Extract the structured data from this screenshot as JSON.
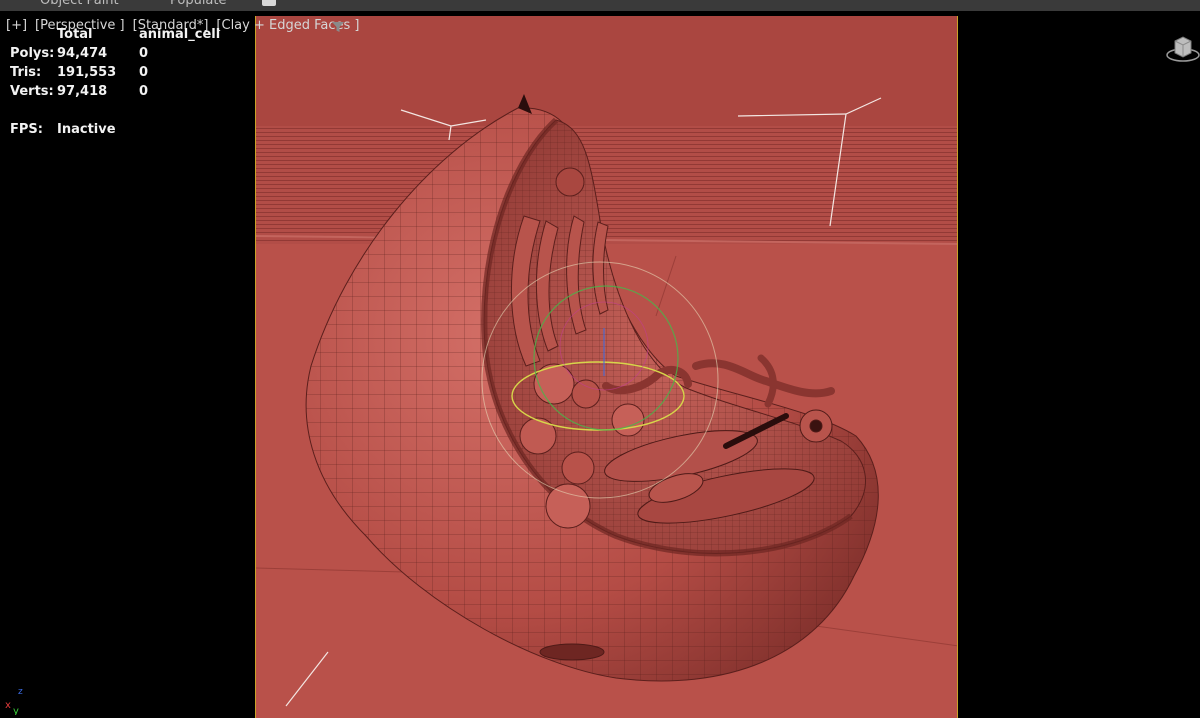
{
  "ribbon": {
    "tabs": [
      "Object Paint",
      "Populate"
    ]
  },
  "viewport": {
    "labels": [
      "[+]",
      "[Perspective ]",
      "[Standard*]",
      "[Clay + Edged Faces ]"
    ],
    "filter_icon": "filter-icon"
  },
  "stats": {
    "header_total": "Total",
    "header_object": "animal_cell",
    "rows": [
      {
        "label": "Polys:",
        "total": "94,474",
        "object": "0"
      },
      {
        "label": "Tris:",
        "total": "191,553",
        "object": "0"
      },
      {
        "label": "Verts:",
        "total": "97,418",
        "object": "0"
      }
    ],
    "fps_label": "FPS:",
    "fps_value": "Inactive"
  },
  "axis_gizmo": {
    "x": "x",
    "y": "y",
    "z": "z"
  },
  "colors": {
    "clay": "#b9514a",
    "clay_dark": "#8a3530",
    "safe_frame": "#c9a227",
    "axis_x": "#e23b3b",
    "axis_y": "#3bd23b",
    "axis_z": "#3b6be2"
  }
}
